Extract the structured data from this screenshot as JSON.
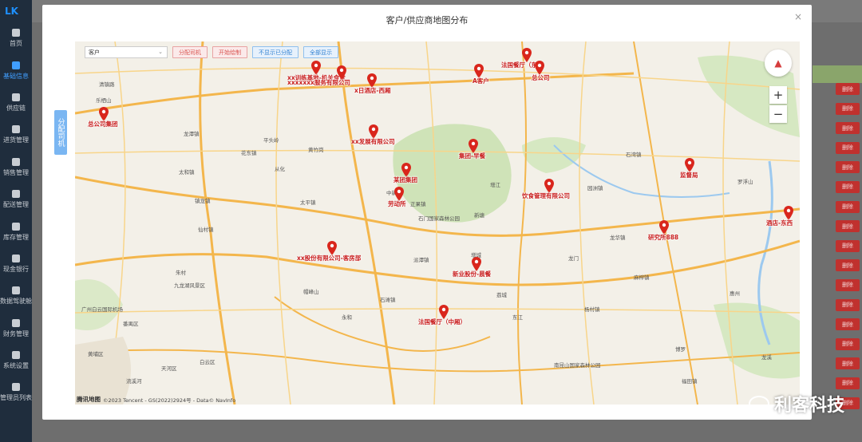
{
  "app": {
    "logo_text": "LK"
  },
  "sidebar": {
    "items": [
      {
        "label": "首页",
        "icon": "dashboard-icon"
      },
      {
        "label": "基础信息",
        "icon": "edit-icon",
        "active": true
      },
      {
        "label": "供应链",
        "icon": "link-icon"
      },
      {
        "label": "进货管理",
        "icon": "inbound-icon"
      },
      {
        "label": "销售管理",
        "icon": "sales-icon"
      },
      {
        "label": "配送管理",
        "icon": "truck-icon"
      },
      {
        "label": "库存管理",
        "icon": "warehouse-icon"
      },
      {
        "label": "现金银行",
        "icon": "cash-icon"
      },
      {
        "label": "数据驾驶舱",
        "icon": "cockpit-icon"
      },
      {
        "label": "财务管理",
        "icon": "finance-icon"
      },
      {
        "label": "系统设置",
        "icon": "gear-icon"
      },
      {
        "label": "管理员列表",
        "icon": "lock-icon"
      }
    ]
  },
  "background": {
    "delete_label": "删除",
    "delete_count": 17
  },
  "modal": {
    "title": "客户/供应商地图分布",
    "close_glyph": "×",
    "assign_driver_label": "分配司机"
  },
  "map": {
    "select_value": "客户",
    "buttons": {
      "assign_driver": "分配司机",
      "start_draw": "开始绘制",
      "hide_assigned": "不显示已分配",
      "show_all": "全部显示"
    },
    "zoom_in": "+",
    "zoom_out": "−",
    "footer_brand": "腾讯地图",
    "footer_text": "©2023 Tencent - GS(2022)2924号 - Data© NavInfo",
    "pins": [
      {
        "label": "总公司集团"
      },
      {
        "label": "xx训练基地-机关食堂"
      },
      {
        "label": "xxxxxxx服务有限公司"
      },
      {
        "label": "x日酒店-西厢"
      },
      {
        "label": "A客户"
      },
      {
        "label": "法国餐厅（东）"
      },
      {
        "label": "总公司"
      },
      {
        "label": "xx发展有限公司"
      },
      {
        "label": "集团-早餐"
      },
      {
        "label": "某团集团"
      },
      {
        "label": "劳动所"
      },
      {
        "label": "饮食管理有限公司"
      },
      {
        "label": "监督局"
      },
      {
        "label": "研究所888"
      },
      {
        "label": "酒店-东西"
      },
      {
        "label": "xx股份有限公司-客房部"
      },
      {
        "label": "新业股份-晨餐"
      },
      {
        "label": "法国餐厅（中厢）"
      }
    ],
    "places": [
      "清镇路",
      "乐栖山",
      "龙潭镇",
      "太和镇",
      "镇龙镇",
      "花东镇",
      "平头岭",
      "黄竹岗",
      "从化",
      "太平镇",
      "中新镇",
      "帽峰山",
      "正果镇",
      "派潭镇",
      "石门国家森林公园",
      "增城",
      "荔城",
      "新塘",
      "永和",
      "石滩镇",
      "仙村镇",
      "朱村",
      "白云区",
      "天河区",
      "黄埔区",
      "番禺区",
      "九龙湖风景区",
      "广州白云国际机场",
      "流溪河",
      "增江",
      "东江",
      "南昆山国家森林公园",
      "龙门",
      "龙华镇",
      "麻榨镇",
      "杨村镇",
      "博罗",
      "罗浮山",
      "惠州",
      "石湾镇",
      "园洲镇",
      "龙溪",
      "福田镇"
    ]
  },
  "watermark": {
    "text": "利客科技"
  },
  "colors": {
    "pin": "#d9261c",
    "sidebar_bg": "#1f2d3d",
    "delete_btn": "#c0312e",
    "accent": "#409eff"
  }
}
